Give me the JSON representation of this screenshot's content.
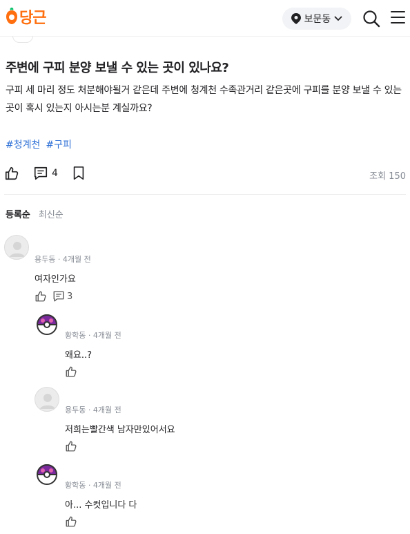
{
  "header": {
    "logo_text": "당근",
    "location_label": "보문동",
    "brand_color": "#ff6f0f"
  },
  "post": {
    "title": "주변에 구피 분양 보낼 수 있는 곳이 있나요?",
    "body": "구피 세 마리 정도 처분해야될거 같은데 주변에 청계천 수족관거리 같은곳에 구피를 분양 보낼 수 있는 곳이 혹시 있는지 아시는분 계실까요?",
    "tags": [
      "#청계천",
      "#구피"
    ],
    "comment_count": "4",
    "views": "조회 150"
  },
  "sort": {
    "registered": "등록순",
    "latest": "최신순"
  },
  "comments": [
    {
      "author": "용두동",
      "time": "4개월 전",
      "text": "여자인가요",
      "reply_count": "3"
    },
    {
      "author": "황학동",
      "time": "4개월 전",
      "text": "왜요..?"
    },
    {
      "author": "용두동",
      "time": "4개월 전",
      "text": "저희는빨간색 남자만있어서요"
    },
    {
      "author": "황학동",
      "time": "4개월 전",
      "text": "아... 수컷입니다 다"
    }
  ],
  "separator": "·"
}
